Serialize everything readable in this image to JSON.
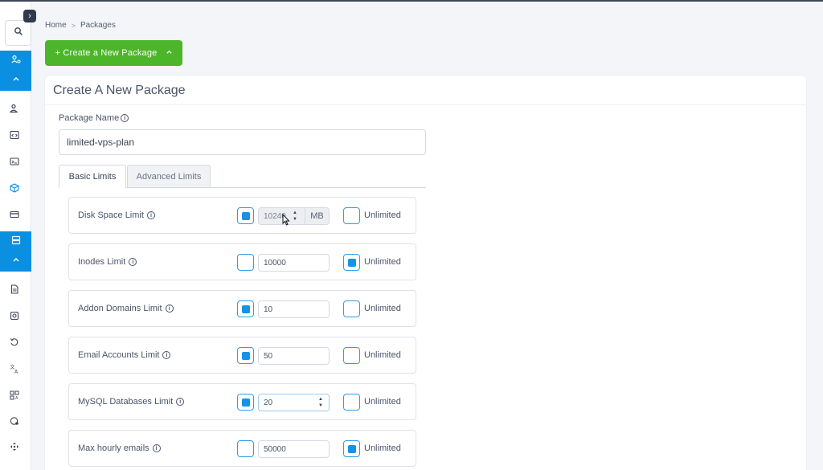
{
  "breadcrumb": {
    "home": "Home",
    "separator": ">",
    "current": "Packages"
  },
  "create_button": {
    "label": "+ Create a New Package",
    "caret": "^"
  },
  "card": {
    "title": "Create A New Package",
    "package_name_label": "Package Name",
    "package_name_value": "limited-vps-plan"
  },
  "tabs": {
    "basic": "Basic Limits",
    "advanced": "Advanced Limits"
  },
  "limits": [
    {
      "label": "Disk Space Limit",
      "left_checked": true,
      "value": "10240",
      "unit": "MB",
      "unlimited_checked": false,
      "unlimited_label": "Unlimited"
    },
    {
      "label": "Inodes Limit",
      "left_checked": false,
      "value": "10000",
      "unit": "",
      "unlimited_checked": true,
      "unlimited_label": "Unlimited"
    },
    {
      "label": "Addon Domains Limit",
      "left_checked": true,
      "value": "10",
      "unit": "",
      "unlimited_checked": false,
      "unlimited_label": "Unlimited"
    },
    {
      "label": "Email Accounts Limit",
      "left_checked": true,
      "value": "50",
      "unit": "",
      "unlimited_checked": false,
      "unlimited_label": "Unlimited"
    },
    {
      "label": "MySQL Databases Limit",
      "left_checked": true,
      "value": "20",
      "unit": "",
      "unlimited_checked": false,
      "unlimited_label": "Unlimited"
    },
    {
      "label": "Max hourly emails",
      "left_checked": false,
      "value": "50000",
      "unit": "",
      "unlimited_checked": true,
      "unlimited_label": "Unlimited"
    }
  ],
  "colors": {
    "accent": "#0b8fe0",
    "create_button": "#4cb52a",
    "checkbox": "#1593e6"
  },
  "sidebar_icons": [
    "search-icon",
    "users-settings-icon",
    "user-icon",
    "code-icon",
    "terminal-icon",
    "package-icon",
    "card-icon",
    "server-icon",
    "document-icon",
    "target-icon",
    "history-icon",
    "translate-icon",
    "qr-icon",
    "shield-icon",
    "move-icon"
  ]
}
